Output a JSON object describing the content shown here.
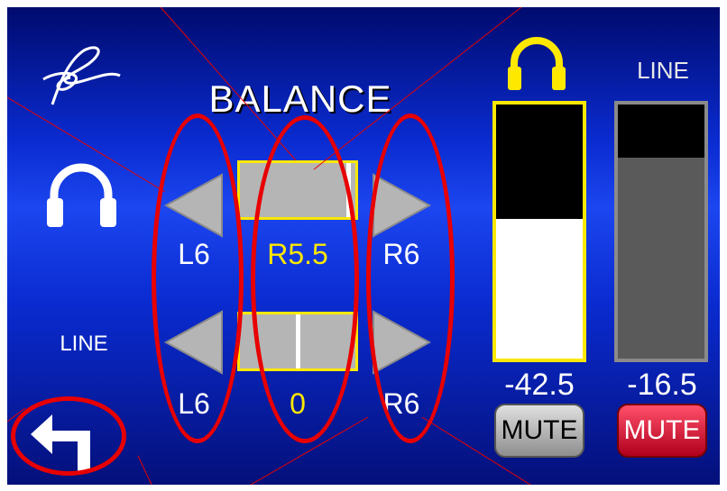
{
  "title": "BALANCE",
  "icons": {
    "logo": "signature-logo-icon",
    "headphones": "headphones-icon",
    "back": "back-arrow-icon",
    "left_arrow": "left-arrow-icon",
    "right_arrow": "right-arrow-icon"
  },
  "colors": {
    "background": "#0a2bd0",
    "accent": "#ffe800",
    "annotation": "#e80000",
    "mute_active": "#d0102e"
  },
  "rows": {
    "headphones": {
      "left_label": "L6",
      "value": "R5.5",
      "right_label": "R6",
      "position_fraction": 0.96
    },
    "line": {
      "label": "LINE",
      "left_label": "L6",
      "value": "0",
      "right_label": "R6",
      "position_fraction": 0.5
    }
  },
  "meters": {
    "headphones": {
      "value": "-42.5",
      "level_fraction": 0.55,
      "mute_label": "MUTE"
    },
    "line": {
      "label": "LINE",
      "value": "-16.5",
      "level_fraction": 0.79,
      "mute_label": "MUTE"
    }
  }
}
